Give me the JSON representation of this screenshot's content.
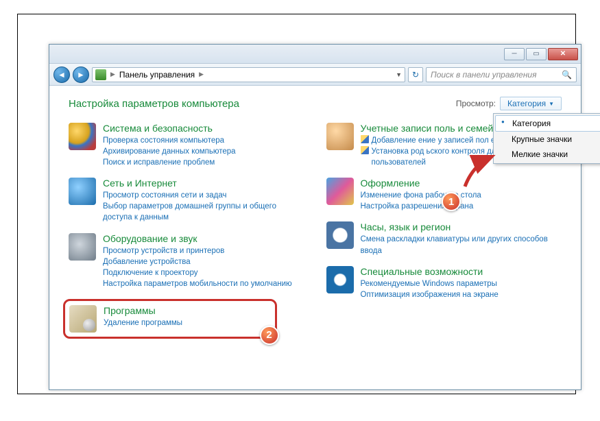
{
  "nav": {
    "location": "Панель управления"
  },
  "search": {
    "placeholder": "Поиск в панели управления"
  },
  "header": {
    "title": "Настройка параметров компьютера",
    "view_label": "Просмотр:",
    "view_value": "Категория"
  },
  "dropdown": {
    "items": [
      "Категория",
      "Крупные значки",
      "Мелкие значки"
    ],
    "selected": 0
  },
  "left": [
    {
      "title": "Система и безопасность",
      "links": [
        {
          "t": "Проверка состояния компьютера"
        },
        {
          "t": "Архивирование данных компьютера"
        },
        {
          "t": "Поиск и исправление проблем"
        }
      ]
    },
    {
      "title": "Сеть и Интернет",
      "links": [
        {
          "t": "Просмотр состояния сети и задач"
        },
        {
          "t": "Выбор параметров домашней группы и общего доступа к данным"
        }
      ]
    },
    {
      "title": "Оборудование и звук",
      "links": [
        {
          "t": "Просмотр устройств и принтеров"
        },
        {
          "t": "Добавление устройства"
        },
        {
          "t": "Подключение к проектору"
        },
        {
          "t": "Настройка параметров мобильности по умолчанию"
        }
      ]
    },
    {
      "title": "Программы",
      "links": [
        {
          "t": "Удаление программы"
        }
      ]
    }
  ],
  "right": [
    {
      "title": "Учетные записи поль и семейн...",
      "links": [
        {
          "t": "Добавление                ение у            записей пол          елей",
          "s": true
        },
        {
          "t": "Установка род             ьского контроля для всех пользователей",
          "s": true
        }
      ]
    },
    {
      "title": "Оформление",
      "links": [
        {
          "t": "Изменение фона рабочего стола"
        },
        {
          "t": "Настройка разрешения экрана"
        }
      ]
    },
    {
      "title": "Часы, язык и регион",
      "links": [
        {
          "t": "Смена раскладки клавиатуры или других способов ввода"
        }
      ]
    },
    {
      "title": "Специальные возможности",
      "links": [
        {
          "t": "Рекомендуемые Windows параметры"
        },
        {
          "t": "Оптимизация изображения на экране"
        }
      ]
    }
  ],
  "badges": {
    "one": "1",
    "two": "2"
  }
}
